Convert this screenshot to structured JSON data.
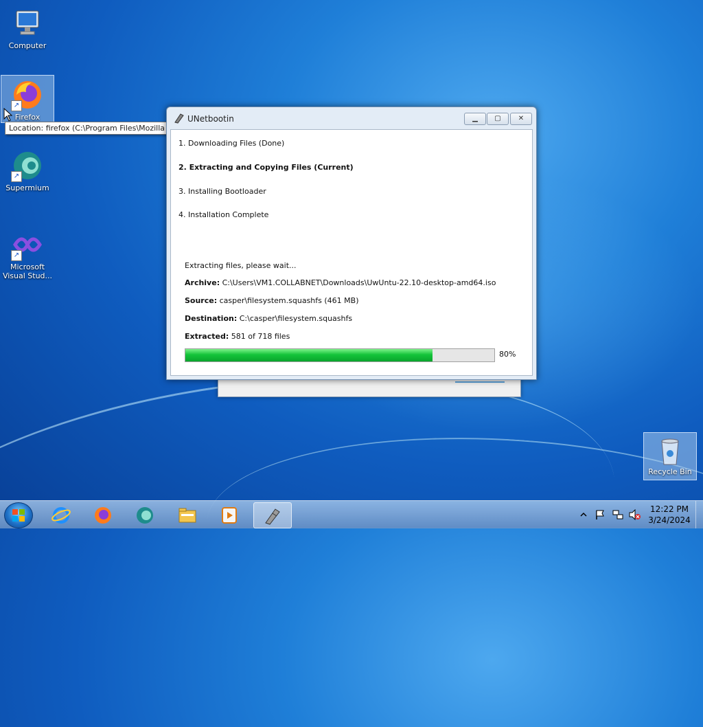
{
  "desktop": {
    "icons": [
      {
        "label": "Computer"
      },
      {
        "label": "Firefox"
      },
      {
        "label": "Supermium"
      },
      {
        "label_line1": "Microsoft",
        "label_line2": "Visual Stud..."
      }
    ],
    "tooltip": "Location: firefox (C:\\Program Files\\Mozilla Firefox)",
    "recycle_bin": "Recycle Bin"
  },
  "window": {
    "title": "UNetbootin",
    "steps": [
      "1. Downloading Files (Done)",
      "2. Extracting and Copying Files (Current)",
      "3. Installing Bootloader",
      "4. Installation Complete"
    ],
    "status": "Extracting files, please wait...",
    "archive_label": "Archive:",
    "archive_value": "C:\\Users\\VM1.COLLABNET\\Downloads\\UwUntu-22.10-desktop-amd64.iso",
    "source_label": "Source:",
    "source_value": "casper\\filesystem.squashfs (461 MB)",
    "destination_label": "Destination:",
    "destination_value": "C:\\casper\\filesystem.squashfs",
    "extracted_label": "Extracted:",
    "extracted_value": "581 of 718 files",
    "progress_percent": 80,
    "progress_text": "80%"
  },
  "taskbar": {
    "items": [
      "internet-explorer-icon",
      "firefox-icon",
      "supermium-icon",
      "file-explorer-icon",
      "media-player-icon",
      "unetbootin-icon"
    ],
    "clock_time": "12:22 PM",
    "clock_date": "3/24/2024"
  },
  "colors": {
    "progress": "#14c43a",
    "desktop": "#1f7fd8"
  }
}
